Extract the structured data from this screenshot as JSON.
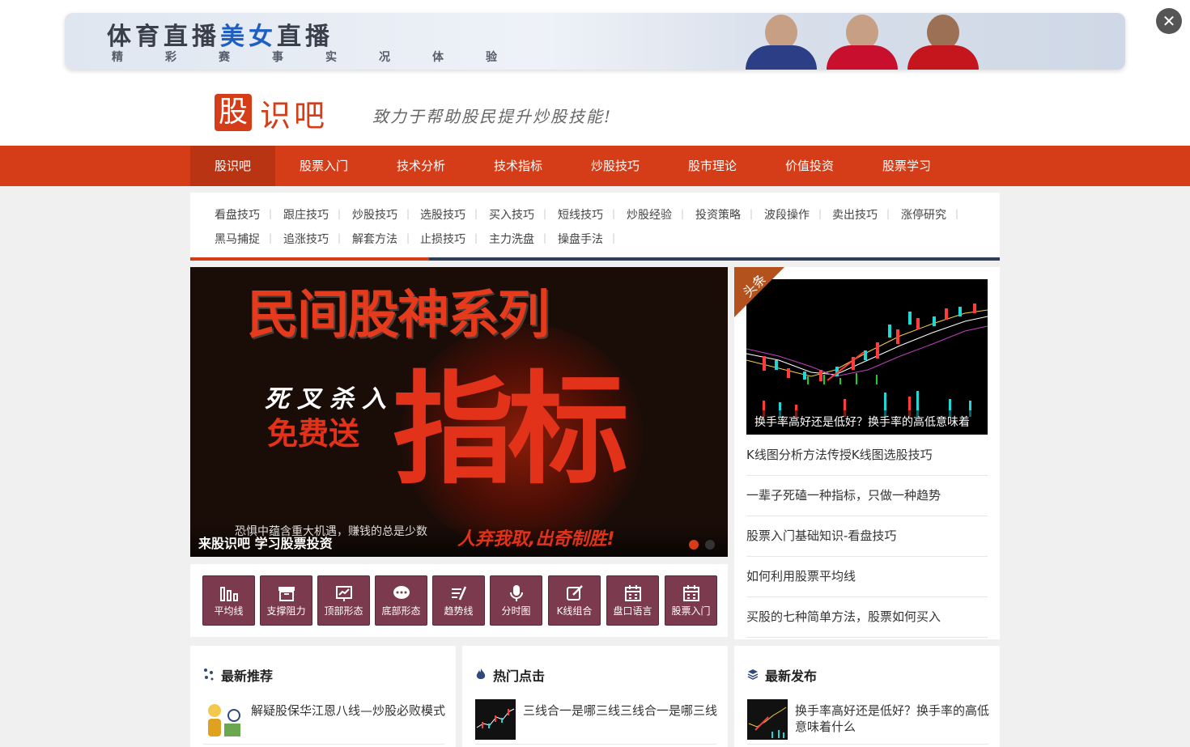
{
  "ad": {
    "title_part1": "体育直播",
    "title_part2": "美女",
    "title_part3": "直播",
    "subtitle": "精彩赛事实况体验",
    "close_label": "✕"
  },
  "site": {
    "logo_box": "股",
    "logo_rest": "识吧",
    "slogan": "致力于帮助股民提升炒股技能!"
  },
  "nav": {
    "items": [
      "股识吧",
      "股票入门",
      "技术分析",
      "技术指标",
      "炒股技巧",
      "股市理论",
      "价值投资",
      "股票学习"
    ]
  },
  "subnav": {
    "row1": [
      "看盘技巧",
      "跟庄技巧",
      "炒股技巧",
      "选股技巧",
      "买入技巧",
      "短线技巧",
      "炒股经验",
      "投资策略",
      "波段操作",
      "卖出技巧",
      "涨停研究"
    ],
    "row2": [
      "黑马捕捉",
      "追涨技巧",
      "解套方法",
      "止损技巧",
      "主力洗盘",
      "操盘手法"
    ]
  },
  "slider": {
    "title": "民间股神系列",
    "big": "指标",
    "left1": "死叉杀入",
    "left2": "免费送",
    "bottom": "人弃我取,出奇制胜!",
    "note": "恐惧中蕴含重大机遇，赚钱的总是少数",
    "caption": "来股识吧 学习股票投资"
  },
  "shortcuts": [
    "平均线",
    "支撑阻力",
    "顶部形态",
    "底部形态",
    "趋势线",
    "分时图",
    "K线组合",
    "盘口语言",
    "股票入门"
  ],
  "headline": {
    "ribbon": "头条",
    "caption": "换手率高好还是低好？换手率的高低意味着",
    "items": [
      "K线图分析方法传授K线图选股技巧",
      "一辈子死磕一种指标，只做一种趋势",
      "股票入门基础知识-看盘技巧",
      "如何利用股票平均线",
      "买股的七种简单方法，股票如何买入"
    ]
  },
  "cards": [
    {
      "title": "最新推荐",
      "icon": "sparkle-icon",
      "text": "解疑股保华江恩八线—炒股必败模式"
    },
    {
      "title": "热门点击",
      "icon": "flame-icon",
      "text": "三线合一是哪三线三线合一是哪三线"
    },
    {
      "title": "最新发布",
      "icon": "layers-icon",
      "text": "换手率高好还是低好？换手率的高低意味着什么"
    }
  ],
  "colors": {
    "brand": "#d43d18",
    "nav_active": "#b93412",
    "shortcut_bg": "#7c3a4e",
    "subnav_dark": "#2f3f5a"
  }
}
